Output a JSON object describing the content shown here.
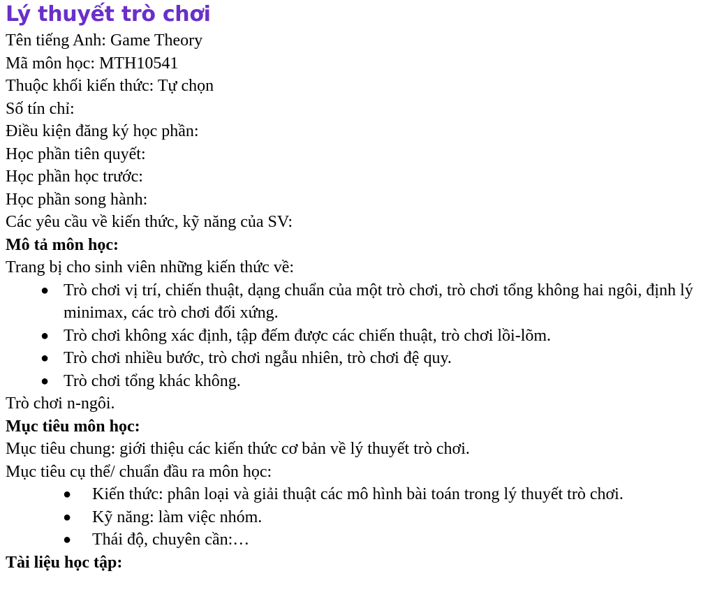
{
  "title": "Lý thuyết trò chơi",
  "info": {
    "english_name": "Tên tiếng Anh: Game Theory",
    "course_code": "Mã môn học: MTH10541",
    "knowledge_block": "Thuộc khối kiến thức: Tự chọn",
    "credits": "Số tín chỉ:",
    "registration_conditions": "Điều kiện đăng ký học phần:",
    "prerequisite": "Học phần tiên quyết:",
    "prior_course": "Học phần học trước:",
    "corequisite": "Học phần song hành:",
    "requirements": "Các yêu cầu về kiến thức, kỹ năng của SV:"
  },
  "description": {
    "heading": "Mô tả môn học:",
    "intro": "Trang bị cho sinh viên những kiến thức về:",
    "bullets": [
      "Trò chơi vị trí, chiến thuật, dạng chuẩn của một trò chơi, trò chơi tổng không hai ngôi, định lý minimax, các trò chơi đối xứng.",
      "Trò chơi không xác định, tập đếm được các chiến thuật, trò chơi lồi-lõm.",
      "Trò chơi nhiều bước, trò chơi ngẫu nhiên, trò chơi đệ quy.",
      "Trò chơi tổng khác không."
    ],
    "after": "Trò chơi n-ngôi."
  },
  "objectives": {
    "heading": "Mục tiêu môn học:",
    "general": "Mục tiêu chung: giới thiệu các kiến thức cơ bản về lý thuyết trò chơi.",
    "specific": "Mục tiêu cụ thể/ chuẩn đầu ra môn học:",
    "bullets": [
      "Kiến thức: phân loại và giải thuật các mô hình bài toán trong lý thuyết trò chơi.",
      "Kỹ năng: làm việc nhóm.",
      "Thái độ, chuyên cần:…"
    ]
  },
  "materials": {
    "heading": "Tài liệu học tập:"
  },
  "bullet_glyph": "●",
  "colors": {
    "title": "#6a2fc9",
    "text": "#000000"
  }
}
